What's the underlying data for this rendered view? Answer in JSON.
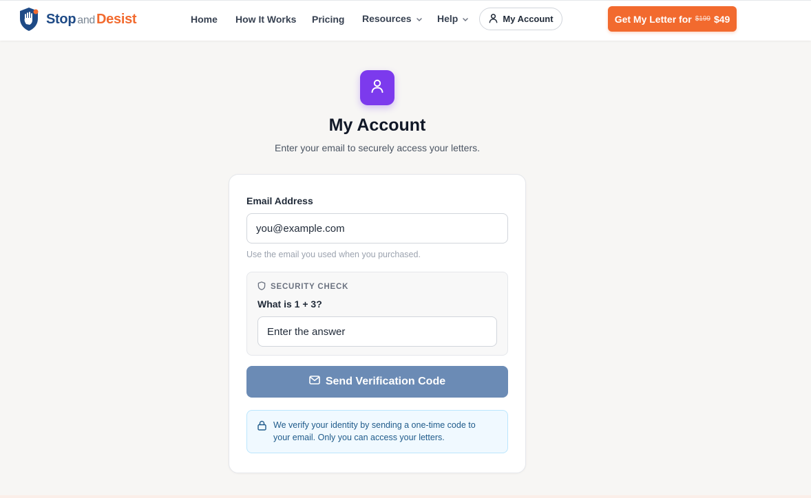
{
  "header": {
    "brand": {
      "stop": "Stop",
      "and": "and",
      "desist": "Desist"
    },
    "nav": [
      {
        "label": "Home"
      },
      {
        "label": "How It Works"
      },
      {
        "label": "Pricing"
      },
      {
        "label": "Resources"
      },
      {
        "label": "Help"
      }
    ],
    "account_button": "My Account",
    "cta": {
      "label": "Get My Letter for",
      "old_price": "$199",
      "price": "$49"
    }
  },
  "main": {
    "title": "My Account",
    "subtitle": "Enter your email to securely access your letters.",
    "form": {
      "email_label": "Email Address",
      "email_placeholder": "you@example.com",
      "email_hint": "Use the email you used when you purchased.",
      "security_heading": "SECURITY CHECK",
      "security_question": "What is 1 + 3?",
      "answer_placeholder": "Enter the answer",
      "submit_label": "Send Verification Code",
      "info_text": "We verify your identity by sending a one-time code to your email. Only you can access your letters."
    }
  },
  "icons": {
    "logo": "shield-hand-icon",
    "account": "user-icon",
    "hero": "user-icon",
    "security": "shield-icon",
    "submit": "mail-icon",
    "info": "lock-icon"
  },
  "colors": {
    "brand_blue": "#1e4a86",
    "brand_orange": "#f26a2e",
    "hero_purple": "#7c3aed",
    "submit_button": "#6b8bb5",
    "info_background": "#f0f9ff"
  }
}
